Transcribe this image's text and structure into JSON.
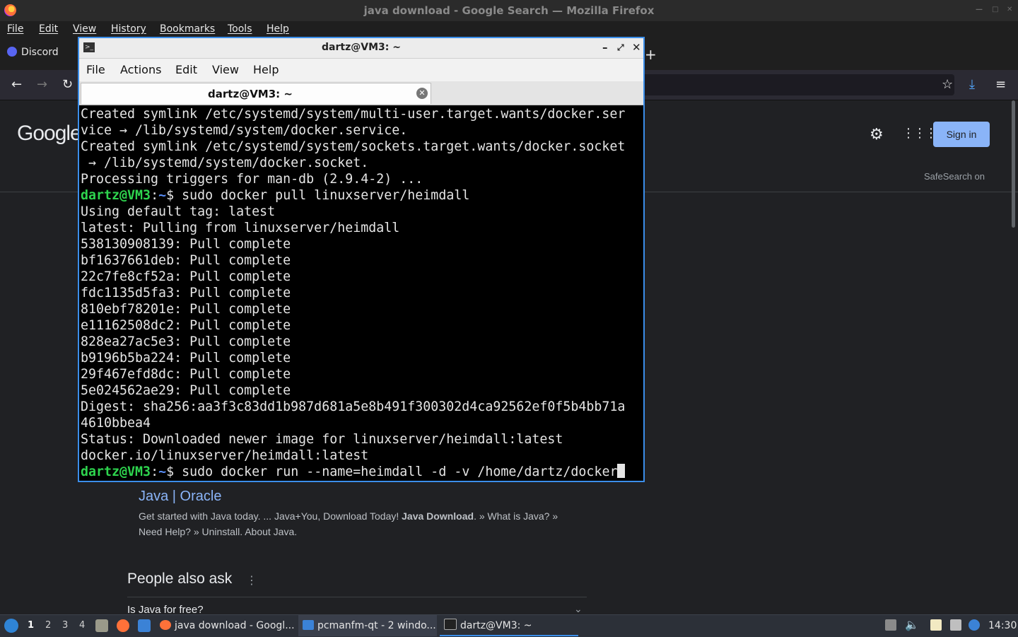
{
  "firefox": {
    "window_title": "java download - Google Search — Mozilla Firefox",
    "menu": [
      "File",
      "Edit",
      "View",
      "History",
      "Bookmarks",
      "Tools",
      "Help"
    ],
    "tab_discord": "Discord",
    "new_tab": "+"
  },
  "google": {
    "logo": "Google",
    "signin": "Sign in",
    "safesearch": "SafeSearch on",
    "result_title": "Java | Oracle",
    "snippet_a": "Get started with Java today. ... Java+You, Download Today! ",
    "snippet_bold": "Java Download",
    "snippet_b": ". » What is Java? » Need Help? » Uninstall. About Java.",
    "paa_title": "People also ask",
    "paa_q1": "Is Java for free?"
  },
  "terminal": {
    "title": "dartz@VM3: ~",
    "menu": [
      "File",
      "Actions",
      "Edit",
      "View",
      "Help"
    ],
    "tab_label": "dartz@VM3: ~",
    "prompt_user": "dartz@VM3",
    "prompt_sep": ":",
    "prompt_path": "~",
    "prompt_dollar": "$ ",
    "lines_before": [
      "Created symlink /etc/systemd/system/multi-user.target.wants/docker.ser",
      "vice → /lib/systemd/system/docker.service.",
      "Created symlink /etc/systemd/system/sockets.target.wants/docker.socket",
      " → /lib/systemd/system/docker.socket.",
      "Processing triggers for man-db (2.9.4-2) ..."
    ],
    "command_1": "sudo docker pull linuxserver/heimdall",
    "lines_after": [
      "Using default tag: latest",
      "latest: Pulling from linuxserver/heimdall",
      "538130908139: Pull complete",
      "bf1637661deb: Pull complete",
      "22c7fe8cf52a: Pull complete",
      "fdc1135d5fa3: Pull complete",
      "810ebf78201e: Pull complete",
      "e11162508dc2: Pull complete",
      "828ea27ac5e3: Pull complete",
      "b9196b5ba224: Pull complete",
      "29f467efd8dc: Pull complete",
      "5e024562ae29: Pull complete",
      "Digest: sha256:aa3f3c83dd1b987d681a5e8b491f300302d4ca92562ef0f5b4bb71a",
      "4610bbea4",
      "Status: Downloaded newer image for linuxserver/heimdall:latest",
      "docker.io/linuxserver/heimdall:latest"
    ],
    "command_2": "sudo docker run --name=heimdall -d -v /home/dartz/docker"
  },
  "taskbar": {
    "workspaces": [
      "1",
      "2",
      "3",
      "4"
    ],
    "tasks": [
      "java download - Googl...",
      "pcmanfm-qt - 2 windo...",
      "dartz@VM3: ~"
    ],
    "clock": "14:30"
  },
  "colors": {
    "prompt_user": "#2ed44e",
    "prompt_path": "#5a8ffa",
    "terminal_border": "#3b8eea",
    "google_link": "#8ab4f8"
  }
}
